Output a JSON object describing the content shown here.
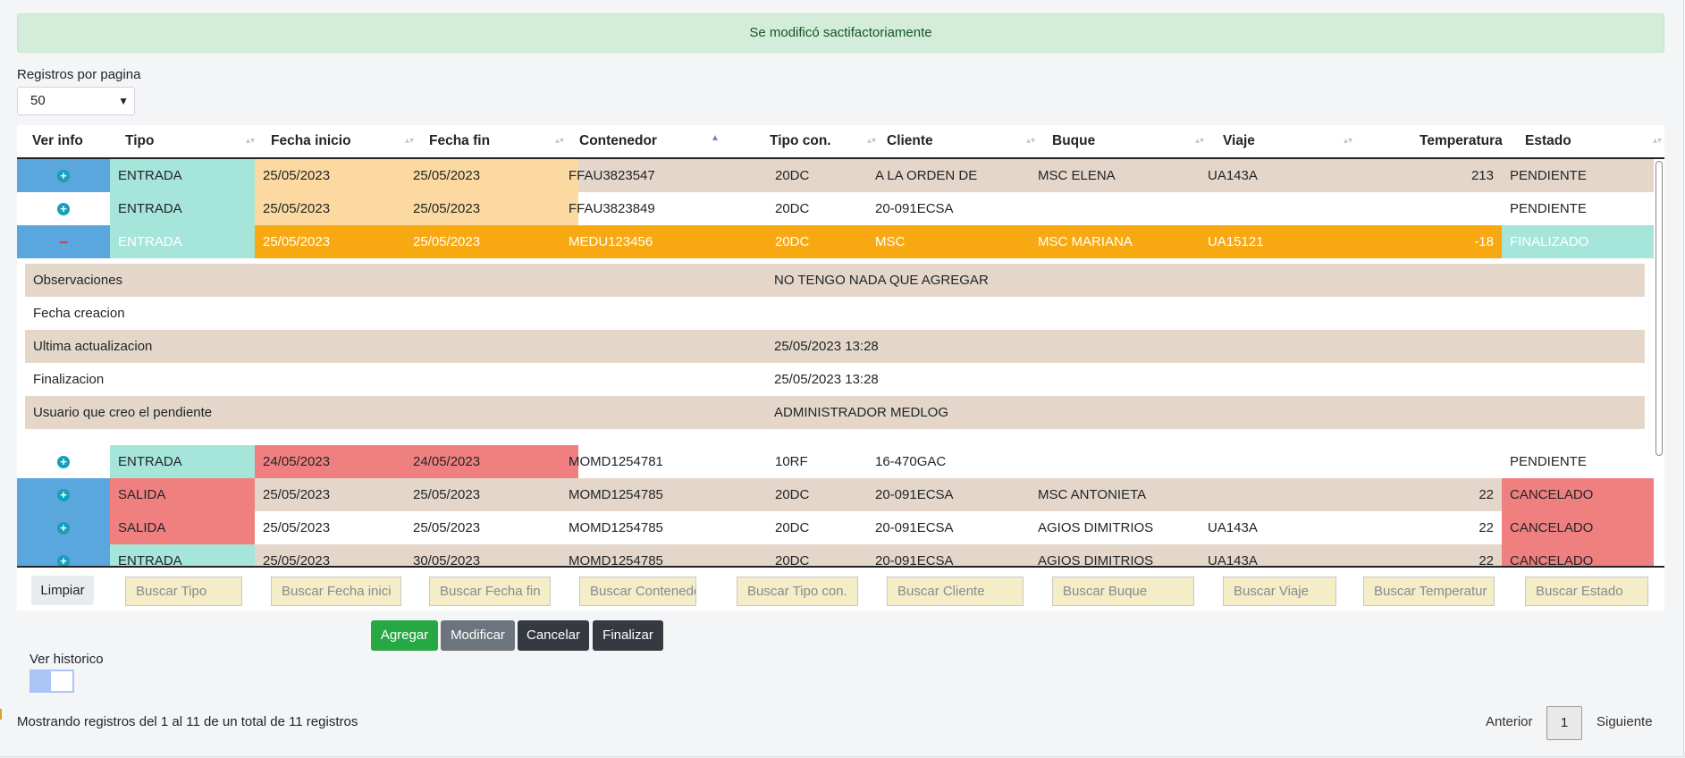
{
  "alert": {
    "message": "Se modificó sactifactoriamente"
  },
  "length": {
    "label": "Registros por pagina",
    "value": "50"
  },
  "columns": [
    {
      "key": "ver",
      "label": "Ver info"
    },
    {
      "key": "tipo",
      "label": "Tipo"
    },
    {
      "key": "fecha_inicio",
      "label": "Fecha inicio"
    },
    {
      "key": "fecha_fin",
      "label": "Fecha fin"
    },
    {
      "key": "contenedor",
      "label": "Contenedor"
    },
    {
      "key": "tipo_con",
      "label": "Tipo con."
    },
    {
      "key": "cliente",
      "label": "Cliente"
    },
    {
      "key": "buque",
      "label": "Buque"
    },
    {
      "key": "viaje",
      "label": "Viaje"
    },
    {
      "key": "temperatura",
      "label": "Temperatura"
    },
    {
      "key": "estado",
      "label": "Estado"
    }
  ],
  "rows": [
    {
      "expanded": false,
      "tipo": "ENTRADA",
      "fecha_inicio": "25/05/2023",
      "fecha_fin": "25/05/2023",
      "contenedor": "FFAU3823547",
      "tipo_con": "20DC",
      "cliente": "A LA ORDEN DE",
      "buque": "MSC ELENA",
      "viaje": "UA143A",
      "temperatura": "213",
      "estado": "PENDIENTE"
    },
    {
      "expanded": false,
      "tipo": "ENTRADA",
      "fecha_inicio": "25/05/2023",
      "fecha_fin": "25/05/2023",
      "contenedor": "FFAU3823849",
      "tipo_con": "20DC",
      "cliente": "20-091ECSA",
      "buque": "",
      "viaje": "",
      "temperatura": "",
      "estado": "PENDIENTE"
    },
    {
      "expanded": true,
      "tipo": "ENTRADA",
      "fecha_inicio": "25/05/2023",
      "fecha_fin": "25/05/2023",
      "contenedor": "MEDU123456",
      "tipo_con": "20DC",
      "cliente": "MSC",
      "buque": "MSC MARIANA",
      "viaje": "UA15121",
      "temperatura": "-18",
      "estado": "FINALIZADO"
    },
    {
      "expanded": false,
      "tipo": "ENTRADA",
      "fecha_inicio": "24/05/2023",
      "fecha_fin": "24/05/2023",
      "contenedor": "MOMD1254781",
      "tipo_con": "10RF",
      "cliente": "16-470GAC",
      "buque": "",
      "viaje": "",
      "temperatura": "",
      "estado": "PENDIENTE"
    },
    {
      "expanded": false,
      "tipo": "SALIDA",
      "fecha_inicio": "25/05/2023",
      "fecha_fin": "25/05/2023",
      "contenedor": "MOMD1254785",
      "tipo_con": "20DC",
      "cliente": "20-091ECSA",
      "buque": "MSC ANTONIETA",
      "viaje": "",
      "temperatura": "22",
      "estado": "CANCELADO"
    },
    {
      "expanded": false,
      "tipo": "SALIDA",
      "fecha_inicio": "25/05/2023",
      "fecha_fin": "25/05/2023",
      "contenedor": "MOMD1254785",
      "tipo_con": "20DC",
      "cliente": "20-091ECSA",
      "buque": "AGIOS DIMITRIOS",
      "viaje": "UA143A",
      "temperatura": "22",
      "estado": "CANCELADO"
    },
    {
      "expanded": false,
      "tipo": "ENTRADA",
      "fecha_inicio": "25/05/2023",
      "fecha_fin": "30/05/2023",
      "contenedor": "MOMD1254785",
      "tipo_con": "20DC",
      "cliente": "20-091ECSA",
      "buque": "AGIOS DIMITRIOS",
      "viaje": "UA143A",
      "temperatura": "22",
      "estado": "CANCELADO"
    }
  ],
  "detail": [
    {
      "label": "Observaciones",
      "value": "NO TENGO NADA QUE AGREGAR"
    },
    {
      "label": "Fecha creacion",
      "value": ""
    },
    {
      "label": "Ultima actualizacion",
      "value": "25/05/2023 13:28"
    },
    {
      "label": "Finalizacion",
      "value": "25/05/2023 13:28"
    },
    {
      "label": "Usuario que creo el pendiente",
      "value": "ADMINISTRADOR MEDLOG"
    }
  ],
  "filters": {
    "clear_label": "Limpiar",
    "placeholders": [
      "Buscar Tipo",
      "Buscar Fecha inici",
      "Buscar Fecha fin",
      "Buscar Contenedo",
      "Buscar Tipo con.",
      "Buscar Cliente",
      "Buscar Buque",
      "Buscar Viaje",
      "Buscar Temperatur",
      "Buscar Estado"
    ]
  },
  "actions": {
    "agregar": "Agregar",
    "modificar": "Modificar",
    "cancelar": "Cancelar",
    "finalizar": "Finalizar"
  },
  "historico": {
    "label": "Ver historico",
    "checked": false
  },
  "info": "Mostrando registros del 1 al 11 de un total de 11 registros",
  "pagination": {
    "prev": "Anterior",
    "page": "1",
    "next": "Siguiente"
  },
  "colors": {
    "tipo_entrada": "#a6e5d9",
    "tipo_salida": "#f08080",
    "fecha_yellow": "#fbd9a0",
    "fecha_red": "#f08080",
    "row_beige": "#e4d7c9",
    "row_orange": "#f8a912",
    "ver_blue": "#5aa7e0",
    "estado_red": "#f08080",
    "estado_green": "#a6e5d9",
    "btn_green": "#28a745",
    "btn_gray": "#6c757d",
    "btn_dark": "#343a40"
  }
}
